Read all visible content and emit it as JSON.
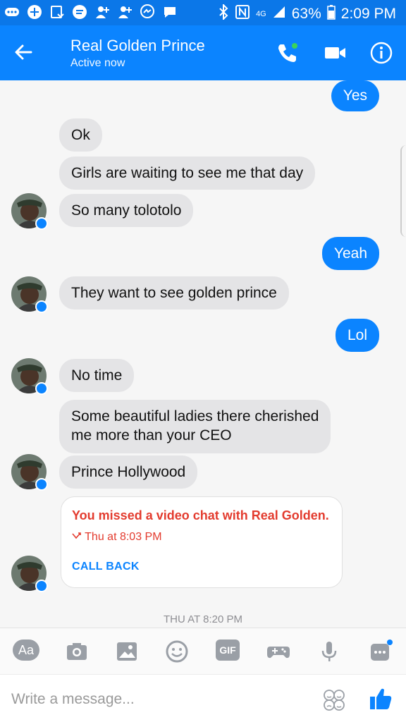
{
  "status_bar": {
    "network": "4G",
    "battery": "63%",
    "time": "2:09 PM"
  },
  "header": {
    "contact_name": "Real Golden Prince",
    "status": "Active now",
    "icons": [
      "back-arrow-icon",
      "phone-icon",
      "video-camera-icon",
      "info-icon"
    ]
  },
  "messages": [
    {
      "from": "me",
      "text": "Yes"
    },
    {
      "from": "them",
      "text": "Ok"
    },
    {
      "from": "them",
      "text": "Girls are waiting to see me that day"
    },
    {
      "from": "them",
      "text": "So many tolotolo"
    },
    {
      "from": "me",
      "text": "Yeah"
    },
    {
      "from": "them",
      "text": "They want to see golden prince"
    },
    {
      "from": "me",
      "text": "Lol"
    },
    {
      "from": "them",
      "text": "No time"
    },
    {
      "from": "them",
      "text": "Some beautiful ladies there cherished"
    },
    {
      "from": "them",
      "text": "me more than your CEO"
    },
    {
      "from": "them",
      "text": "Prince Hollywood"
    }
  ],
  "missed_call": {
    "title": "You missed a video chat with Real Golden.",
    "time": "Thu at 8:03 PM",
    "action": "CALL BACK"
  },
  "timestamp": "THU AT 8:20 PM",
  "toolbar": {
    "text_button": "Aa",
    "gif_button": "GIF",
    "icons": [
      "text-icon",
      "camera-icon",
      "gallery-icon",
      "emoji-icon",
      "gif-icon",
      "game-icon",
      "microphone-icon",
      "more-icon"
    ]
  },
  "composer": {
    "placeholder": "Write a message..."
  },
  "colors": {
    "header": "#0b84ff",
    "status_bar": "#0b77e8",
    "outgoing_bubble": "#0b84ff",
    "incoming_bubble": "#e4e4e6",
    "missed_call_red": "#e33b2e"
  }
}
